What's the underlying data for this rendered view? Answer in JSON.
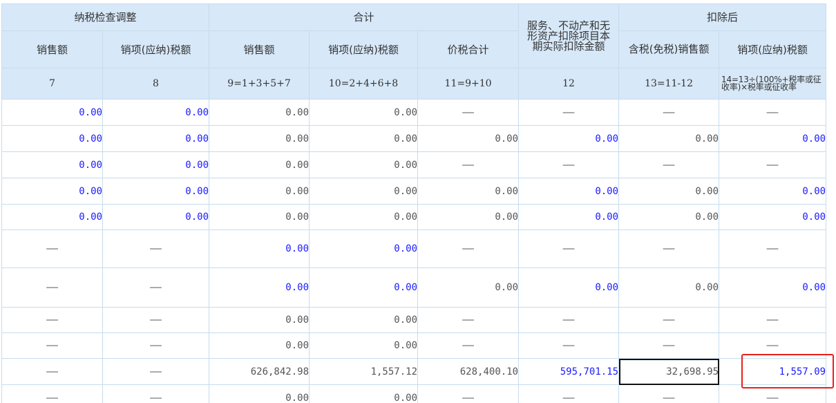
{
  "header": {
    "groups": [
      {
        "label": "纳税检查调整"
      },
      {
        "label": "合计"
      },
      {
        "label": "服务、不动产和无形资产扣除项目本期实际扣除金额"
      },
      {
        "label": "扣除后"
      }
    ],
    "columns": [
      "销售额",
      "销项(应纳)税额",
      "销售额",
      "销项(应纳)税额",
      "价税合计",
      "含税(免税)销售额",
      "销项(应纳)税额"
    ],
    "formulas": [
      "7",
      "8",
      "9=1+3+5+7",
      "10=2+4+6+8",
      "11=9+10",
      "12",
      "13=11-12",
      "14=13÷(100%+税率或征收率)×税率或征收率"
    ]
  },
  "rows": [
    [
      {
        "v": "0.00",
        "t": "edit"
      },
      {
        "v": "0.00",
        "t": "edit"
      },
      {
        "v": "0.00",
        "t": "calc"
      },
      {
        "v": "0.00",
        "t": "calc"
      },
      {
        "v": "——",
        "t": "dash"
      },
      {
        "v": "——",
        "t": "dash"
      },
      {
        "v": "——",
        "t": "dash"
      },
      {
        "v": "——",
        "t": "dash"
      }
    ],
    [
      {
        "v": "0.00",
        "t": "edit"
      },
      {
        "v": "0.00",
        "t": "edit"
      },
      {
        "v": "0.00",
        "t": "calc"
      },
      {
        "v": "0.00",
        "t": "calc"
      },
      {
        "v": "0.00",
        "t": "calc"
      },
      {
        "v": "0.00",
        "t": "edit"
      },
      {
        "v": "0.00",
        "t": "calc"
      },
      {
        "v": "0.00",
        "t": "edit"
      }
    ],
    [
      {
        "v": "0.00",
        "t": "edit"
      },
      {
        "v": "0.00",
        "t": "edit"
      },
      {
        "v": "0.00",
        "t": "calc"
      },
      {
        "v": "0.00",
        "t": "calc"
      },
      {
        "v": "——",
        "t": "dash"
      },
      {
        "v": "——",
        "t": "dash"
      },
      {
        "v": "——",
        "t": "dash"
      },
      {
        "v": "——",
        "t": "dash"
      }
    ],
    [
      {
        "v": "0.00",
        "t": "edit"
      },
      {
        "v": "0.00",
        "t": "edit"
      },
      {
        "v": "0.00",
        "t": "calc"
      },
      {
        "v": "0.00",
        "t": "calc"
      },
      {
        "v": "0.00",
        "t": "calc"
      },
      {
        "v": "0.00",
        "t": "edit"
      },
      {
        "v": "0.00",
        "t": "calc"
      },
      {
        "v": "0.00",
        "t": "edit"
      }
    ],
    [
      {
        "v": "0.00",
        "t": "edit"
      },
      {
        "v": "0.00",
        "t": "edit"
      },
      {
        "v": "0.00",
        "t": "calc"
      },
      {
        "v": "0.00",
        "t": "calc"
      },
      {
        "v": "0.00",
        "t": "calc"
      },
      {
        "v": "0.00",
        "t": "edit"
      },
      {
        "v": "0.00",
        "t": "calc"
      },
      {
        "v": "0.00",
        "t": "edit"
      }
    ],
    [
      {
        "v": "——",
        "t": "dash"
      },
      {
        "v": "——",
        "t": "dash"
      },
      {
        "v": "0.00",
        "t": "edit"
      },
      {
        "v": "0.00",
        "t": "edit"
      },
      {
        "v": "——",
        "t": "dash"
      },
      {
        "v": "——",
        "t": "dash"
      },
      {
        "v": "——",
        "t": "dash"
      },
      {
        "v": "——",
        "t": "dash"
      }
    ],
    [
      {
        "v": "——",
        "t": "dash"
      },
      {
        "v": "——",
        "t": "dash"
      },
      {
        "v": "0.00",
        "t": "edit"
      },
      {
        "v": "0.00",
        "t": "edit"
      },
      {
        "v": "0.00",
        "t": "calc"
      },
      {
        "v": "0.00",
        "t": "edit"
      },
      {
        "v": "0.00",
        "t": "calc"
      },
      {
        "v": "0.00",
        "t": "edit"
      }
    ],
    [
      {
        "v": "——",
        "t": "dash"
      },
      {
        "v": "——",
        "t": "dash"
      },
      {
        "v": "0.00",
        "t": "calc"
      },
      {
        "v": "0.00",
        "t": "calc"
      },
      {
        "v": "——",
        "t": "dash"
      },
      {
        "v": "——",
        "t": "dash"
      },
      {
        "v": "——",
        "t": "dash"
      },
      {
        "v": "——",
        "t": "dash"
      }
    ],
    [
      {
        "v": "——",
        "t": "dash"
      },
      {
        "v": "——",
        "t": "dash"
      },
      {
        "v": "0.00",
        "t": "calc"
      },
      {
        "v": "0.00",
        "t": "calc"
      },
      {
        "v": "——",
        "t": "dash"
      },
      {
        "v": "——",
        "t": "dash"
      },
      {
        "v": "——",
        "t": "dash"
      },
      {
        "v": "——",
        "t": "dash"
      }
    ],
    [
      {
        "v": "——",
        "t": "dash"
      },
      {
        "v": "——",
        "t": "dash"
      },
      {
        "v": "626,842.98",
        "t": "calc"
      },
      {
        "v": "1,557.12",
        "t": "calc"
      },
      {
        "v": "628,400.10",
        "t": "calc"
      },
      {
        "v": "595,701.15",
        "t": "edit"
      },
      {
        "v": "32,698.95",
        "t": "calc",
        "selected": true
      },
      {
        "v": "1,557.09",
        "t": "edit",
        "highlighted": true
      }
    ],
    [
      {
        "v": "——",
        "t": "dash"
      },
      {
        "v": "——",
        "t": "dash"
      },
      {
        "v": "0.00",
        "t": "calc"
      },
      {
        "v": "0.00",
        "t": "calc"
      },
      {
        "v": "——",
        "t": "dash"
      },
      {
        "v": "——",
        "t": "dash"
      },
      {
        "v": "——",
        "t": "dash"
      },
      {
        "v": "——",
        "t": "dash"
      }
    ]
  ],
  "colors": {
    "header_bg": "#d7e8f8",
    "grid_line": "#c6dced",
    "editable_text": "#1a1aff",
    "computed_text": "#555555",
    "highlight_box": "#e8201a"
  }
}
